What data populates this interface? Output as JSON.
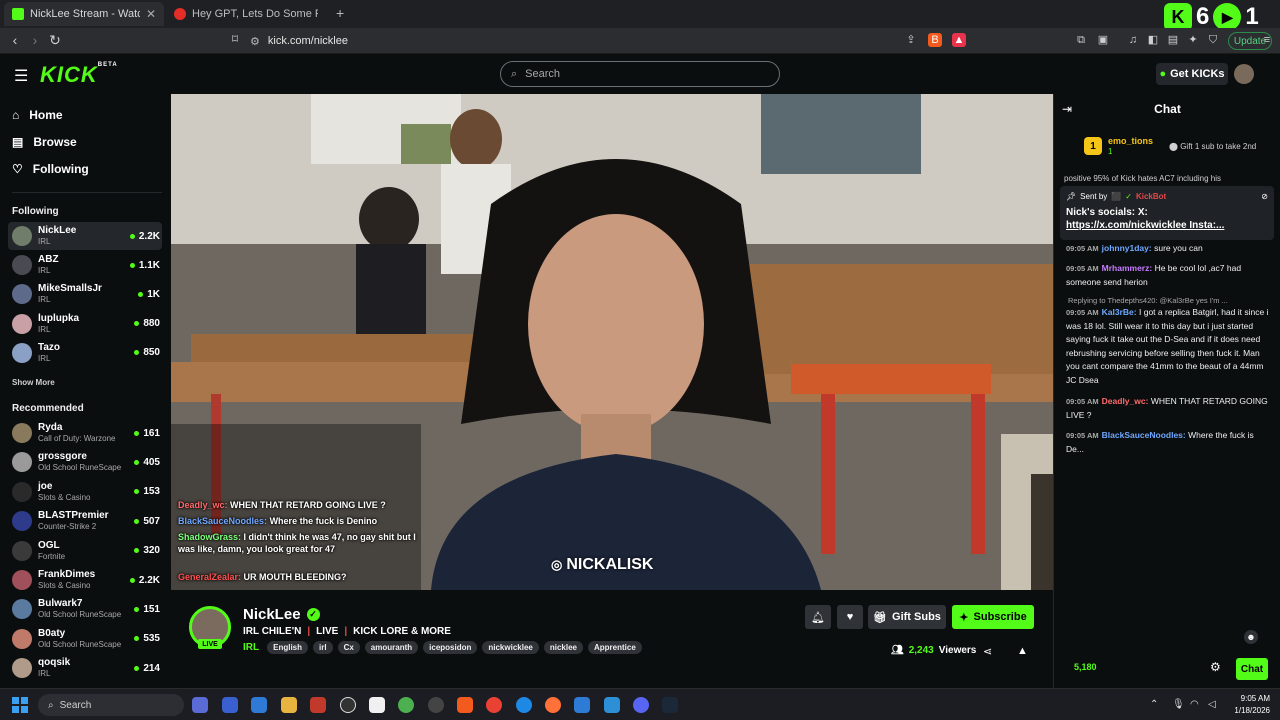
{
  "browser": {
    "tabs": [
      {
        "title": "NickLee Stream - Watch Live",
        "active": true
      },
      {
        "title": "Hey GPT, Lets Do Some Riddles - Yo",
        "active": false
      }
    ],
    "new_tab": "+",
    "url": "kick.com/nicklee",
    "update_label": "Update"
  },
  "overlay": {
    "count_a": "6",
    "count_b": "1"
  },
  "kick_header": {
    "logo": "KICK",
    "logo_beta": "BETA",
    "search_placeholder": "Search",
    "get_kicks_label": "Get KICKs"
  },
  "sidebar": {
    "nav": [
      {
        "label": "Home",
        "icon": "home-icon"
      },
      {
        "label": "Browse",
        "icon": "browse-icon"
      },
      {
        "label": "Following",
        "icon": "heart-icon"
      }
    ],
    "following_heading": "Following",
    "following": [
      {
        "name": "NickLee",
        "category": "IRL",
        "viewers": "2.2K",
        "color": "#6f7d6a"
      },
      {
        "name": "ABZ",
        "category": "IRL",
        "viewers": "1.1K",
        "color": "#4a4a52"
      },
      {
        "name": "MikeSmallsJr",
        "category": "IRL",
        "viewers": "1K",
        "color": "#5d6a8a"
      },
      {
        "name": "luplupka",
        "category": "IRL",
        "viewers": "880",
        "color": "#c9a0a6"
      },
      {
        "name": "Tazo",
        "category": "IRL",
        "viewers": "850",
        "color": "#8aa0c4"
      }
    ],
    "show_more": "Show More",
    "recommended_heading": "Recommended",
    "recommended": [
      {
        "name": "Ryda",
        "category": "Call of Duty: Warzone",
        "viewers": "161",
        "color": "#8a7a5d"
      },
      {
        "name": "grossgore",
        "category": "Old School RuneScape",
        "viewers": "405",
        "color": "#9a9a9a"
      },
      {
        "name": "joe",
        "category": "Slots & Casino",
        "viewers": "153",
        "color": "#2a2a2a"
      },
      {
        "name": "BLASTPremier",
        "category": "Counter-Strike 2",
        "viewers": "507",
        "color": "#2d3b8a"
      },
      {
        "name": "OGL",
        "category": "Fortnite",
        "viewers": "320",
        "color": "#3a3a3a"
      },
      {
        "name": "FrankDimes",
        "category": "Slots & Casino",
        "viewers": "2.2K",
        "color": "#a0505a"
      },
      {
        "name": "Bulwark7",
        "category": "Old School RuneScape",
        "viewers": "151",
        "color": "#5a7aa0"
      },
      {
        "name": "B0aty",
        "category": "Old School RuneScape",
        "viewers": "535",
        "color": "#c07a6a"
      },
      {
        "name": "qoqsik",
        "category": "IRL",
        "viewers": "214",
        "color": "#b09a8a"
      }
    ]
  },
  "video": {
    "overlay_chat": [
      {
        "user": "Deadly_wc:",
        "text": "WHEN THAT RETARD GOING LIVE ?",
        "color": "#ff6b6b"
      },
      {
        "user": "BlackSauceNoodles:",
        "text": "Where the fuck is Denino",
        "color": "#6fa8ff"
      },
      {
        "user": "ShadowGrass:",
        "text": "I didn't think he was 47, no gay shit but I was like, damn, you look great for 47",
        "color": "#7dff7d"
      },
      {
        "user": "GeneralZealar:",
        "text": "UR MOUTH BLEEDING?",
        "color": "#ff5050"
      }
    ],
    "watermark": "NICKALISK"
  },
  "stream_info": {
    "streamer": "NickLee",
    "title_parts": [
      "IRL CHILE'N",
      "LIVE",
      "KICK LORE & MORE"
    ],
    "live_badge": "LIVE",
    "category": "IRL",
    "tags": [
      "English",
      "irl",
      "Cx",
      "amouranth",
      "iceposidon",
      "nickwicklee",
      "nicklee",
      "Apprentice"
    ],
    "gift_subs_label": "Gift Subs",
    "subscribe_label": "Subscribe",
    "viewers": "2,243",
    "viewers_label": "Viewers"
  },
  "chat": {
    "heading": "Chat",
    "pinned": {
      "rank": "1",
      "user": "emo_tions",
      "count": "1",
      "gift_text": "Gift 1 sub to take 2nd"
    },
    "truncated_top": "positive 95% of Kick hates AC7 including his",
    "kickbot": {
      "sent_by": "Sent by",
      "bot_name": "KickBot",
      "message_a": "Nick's socials: X:",
      "message_b": "https://x.com/nickwicklee Insta:..."
    },
    "messages": [
      {
        "time": "09:05 AM",
        "user": "johnny1day:",
        "text": "sure you can",
        "color": "#6fa8ff"
      },
      {
        "time": "09:05 AM",
        "user": "Mrhammerz:",
        "text": "He be cool lol ,ac7 had someone send herion",
        "color": "#c77dff"
      },
      {
        "time": "09:05 AM",
        "user": "Kal3rBe:",
        "text": "I got a replica Batgirl, had it since i was 18 lol. Still wear it to this day but i just started saying fuck it take out the D-Sea and if it does need rebrushing servicing before selling then fuck it. Man you cant compare the 41mm to the beaut of a 44mm JC Dsea",
        "color": "#6fa8ff"
      },
      {
        "time": "09:05 AM",
        "user": "Deadly_wc:",
        "text": "WHEN THAT RETARD GOING LIVE ?",
        "color": "#ff6b6b"
      },
      {
        "time": "09:05 AM",
        "user": "BlackSauceNoodles:",
        "text": "Where the fuck is De...",
        "color": "#6fa8ff"
      }
    ],
    "reply_text": "Replying to Thedepths420: @Kal3rBe yes I'm ...",
    "points": "5,180",
    "chat_button": "Chat"
  },
  "taskbar": {
    "search_label": "Search",
    "time": "9:05 AM",
    "date": "1/18/2026"
  }
}
